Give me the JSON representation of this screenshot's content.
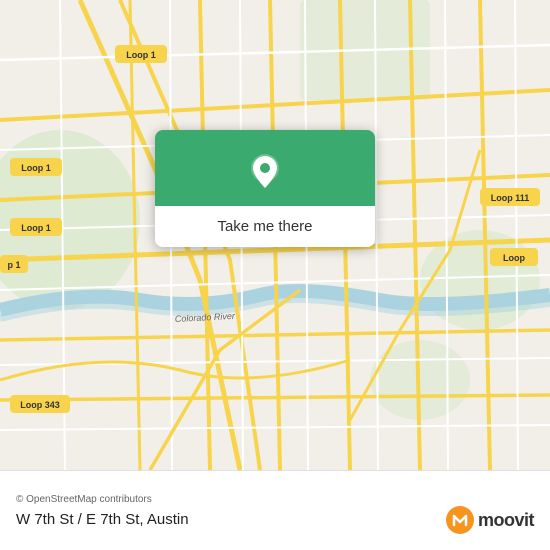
{
  "map": {
    "attribution": "© OpenStreetMap contributors",
    "roads_color": "#f7d44c",
    "background_color": "#f2efe9",
    "water_color": "#aad3df",
    "green_color": "#c8e6c9"
  },
  "popup": {
    "button_label": "Take me there",
    "green_color": "#3aaa6e",
    "pin_color": "white"
  },
  "bottom_bar": {
    "attribution": "© OpenStreetMap contributors",
    "location": "W 7th St / E 7th St, Austin"
  },
  "moovit": {
    "logo_text": "moovit",
    "icon_color": "#f7941d"
  },
  "map_labels": {
    "loop1_top": "Loop 1",
    "loop1_mid": "Loop 1",
    "loop1_left": "Loop 1",
    "loop111": "Loop 111",
    "loop": "Loop",
    "loop343": "Loop 343",
    "p1": "p 1",
    "colorado_river": "Colorado River"
  }
}
